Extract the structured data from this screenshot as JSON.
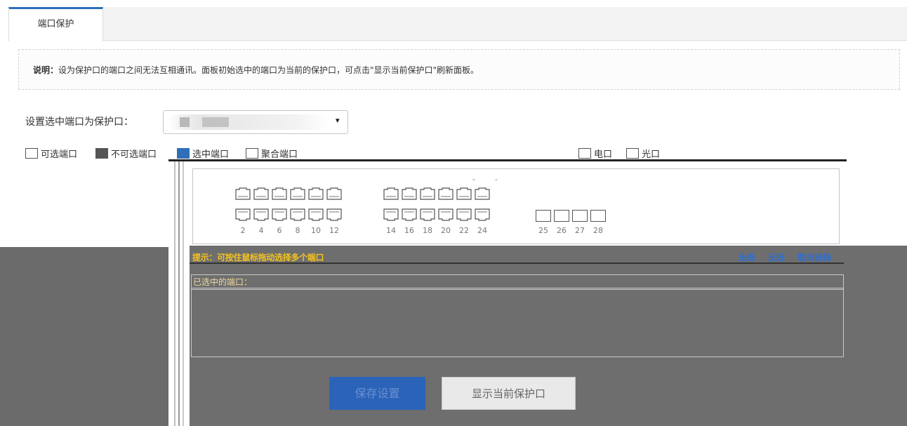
{
  "tabs": [
    {
      "label": "端口保护",
      "active": true
    }
  ],
  "note": {
    "label": "说明：",
    "text": "设为保护口的端口之间无法互相通讯。面板初始选中的端口为当前的保护口，可点击\"显示当前保护口\"刷新面板。"
  },
  "protect": {
    "label": "设置选中端口为保护口：",
    "arrow": "▾"
  },
  "legend": {
    "selectable": "可选端口",
    "unselectable": "不可选端口",
    "selected": "选中端口",
    "aggregate": "聚合端口",
    "electrical": "电口",
    "optical": "光口"
  },
  "panel": {
    "top_marks": [
      "-",
      "-"
    ],
    "port_numbers": [
      "2",
      "4",
      "6",
      "8",
      "10",
      "12",
      "14",
      "16",
      "18",
      "20",
      "22",
      "24",
      "25",
      "26",
      "27",
      "28"
    ]
  },
  "hint": {
    "text": "提示：可按住鼠标拖动选择多个端口",
    "select_all": "全选",
    "invert": "反选",
    "cancel": "取消选择"
  },
  "ports_list": {
    "title": "已选中的端口：",
    "value": ""
  },
  "buttons": {
    "save": "保存设置",
    "show_current": "显示当前保护口"
  },
  "colors": {
    "accent": "#2b63b8",
    "hint": "#f4c220",
    "dark_overlay": "#6e6e6e"
  }
}
